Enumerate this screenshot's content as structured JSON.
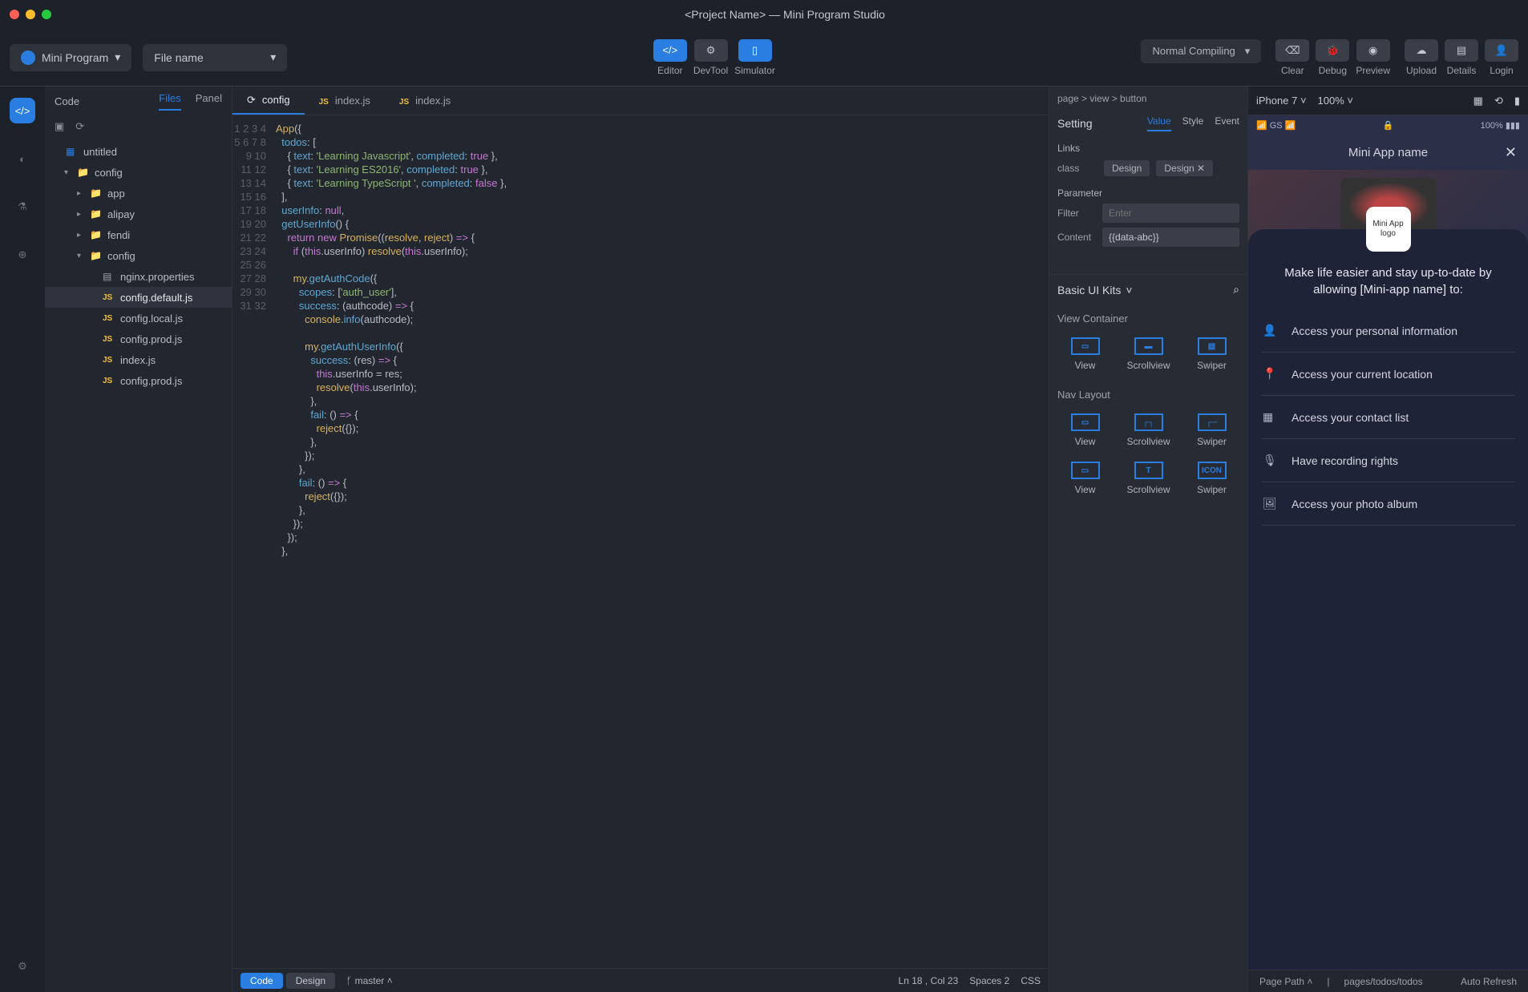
{
  "titlebar": {
    "title": "<Project Name> — Mini Program Studio"
  },
  "toolbar": {
    "project_pill": "Mini Program",
    "file_pill": "File name",
    "center": [
      {
        "label": "Editor",
        "active": true
      },
      {
        "label": "DevTool",
        "active": false
      },
      {
        "label": "Simulator",
        "active": true
      }
    ],
    "compile_dropdown": "Normal Compiling",
    "actions": [
      "Clear",
      "Debug",
      "Preview"
    ],
    "account": [
      "Upload",
      "Details",
      "Login"
    ]
  },
  "sidebar": {
    "hdr": "Code",
    "tabs": {
      "files": "Files",
      "panel": "Panel"
    },
    "tree": [
      {
        "d": 0,
        "icon": "grid",
        "label": "untitled"
      },
      {
        "d": 1,
        "chev": "▾",
        "icon": "folder",
        "label": "config"
      },
      {
        "d": 2,
        "chev": "▸",
        "icon": "folder",
        "label": "app"
      },
      {
        "d": 2,
        "chev": "▸",
        "icon": "folder",
        "label": "alipay"
      },
      {
        "d": 2,
        "chev": "▸",
        "icon": "folder",
        "label": "fendi"
      },
      {
        "d": 2,
        "chev": "▾",
        "icon": "folder-open",
        "label": "config"
      },
      {
        "d": 3,
        "icon": "txt",
        "label": "nginx.properties"
      },
      {
        "d": 3,
        "icon": "js",
        "label": "config.default.js",
        "selected": true
      },
      {
        "d": 3,
        "icon": "js",
        "label": "config.local.js"
      },
      {
        "d": 3,
        "icon": "js",
        "label": "config.prod.js"
      },
      {
        "d": 3,
        "icon": "js",
        "label": "index.js"
      },
      {
        "d": 3,
        "icon": "js",
        "label": "config.prod.js"
      }
    ]
  },
  "tabs": [
    {
      "label": "config",
      "icon": "⟳",
      "active": true
    },
    {
      "label": "index.js",
      "icon": "js"
    },
    {
      "label": "index.js",
      "icon": "js"
    }
  ],
  "code": {
    "lines": 32,
    "raw": "App({\n  todos: [\n    { text: 'Learning Javascript', completed: true },\n    { text: 'Learning ES2016', completed: true },\n    { text: 'Learning TypeScript ', completed: false },\n  ],\n  userInfo: null,\n  getUserInfo() {\n    return new Promise((resolve, reject) => {\n      if (this.userInfo) resolve(this.userInfo);\n\n      my.getAuthCode({\n        scopes: ['auth_user'],\n        success: (authcode) => {\n          console.info(authcode);\n\n          my.getAuthUserInfo({\n            success: (res) => {\n              this.userInfo = res;\n              resolve(this.userInfo);\n            },\n            fail: () => {\n              reject({});\n            },\n          });\n        },\n        fail: () => {\n          reject({});\n        },\n      });\n    });\n  },"
  },
  "footer": {
    "seg_code": "Code",
    "seg_design": "Design",
    "branch": "master",
    "ln_col": "Ln 18 , Col 23",
    "spaces": "Spaces 2",
    "lang": "CSS"
  },
  "inspector": {
    "crumb": "page > view > button",
    "setting": "Setting",
    "tabs": [
      "Value",
      "Style",
      "Event"
    ],
    "links_label": "Links",
    "class_label": "class",
    "chips": [
      "Design",
      "Design"
    ],
    "param_label": "Parameter",
    "filter_label": "Filter",
    "filter_placeholder": "Enter",
    "content_label": "Content",
    "content_value": "{{data-abc}}",
    "kits_hdr": "Basic UI Kits",
    "kits_sec1": "View Container",
    "kits1": [
      "View",
      "Scrollview",
      "Swiper"
    ],
    "kits_sec2": "Nav Layout",
    "kits2": [
      "View",
      "Scrollview",
      "Swiper",
      "View",
      "Scrollview",
      "Swiper"
    ]
  },
  "sim": {
    "device": "iPhone 7",
    "zoom": "100%",
    "status_left": "📶 GS 📶",
    "status_right": "100% ▮▮▮",
    "app_title": "Mini App name",
    "logo_text": "Mini App logo",
    "prompt": "Make life easier and stay up-to-date by allowing [Mini-app name] to:",
    "perms": [
      "Access your personal information",
      "Access your current location",
      "Access your contact list",
      "Have recording rights",
      "Access your photo album"
    ]
  },
  "statusbar": {
    "page_path": "Page Path",
    "path": "pages/todos/todos",
    "auto_refresh": "Auto Refresh"
  }
}
